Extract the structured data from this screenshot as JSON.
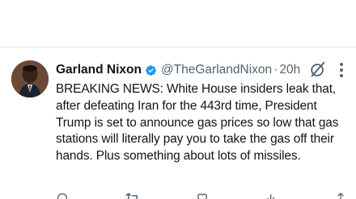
{
  "tweet": {
    "author": {
      "display_name": "Garland Nixon",
      "handle": "@TheGarlandNixon",
      "separator": "·",
      "timestamp": "20h",
      "verified_icon": "verified-badge-icon",
      "avatar_icon": "avatar"
    },
    "body_text": "BREAKING NEWS: White House insiders leak that,  after defeating Iran for the 443rd time, President Trump is set to announce gas prices so low that gas stations will literally pay you to take the gas off their hands. Plus something about lots of missiles.",
    "header_icons": [
      "grok-icon",
      "more-options-icon"
    ],
    "actions": [
      "reply-icon",
      "repost-icon",
      "like-icon",
      "views-icon",
      "share-icon"
    ]
  },
  "colors": {
    "text_primary": "#0f1419",
    "text_secondary": "#536471",
    "verified_blue": "#1d9bf0",
    "background": "#ffffff"
  }
}
